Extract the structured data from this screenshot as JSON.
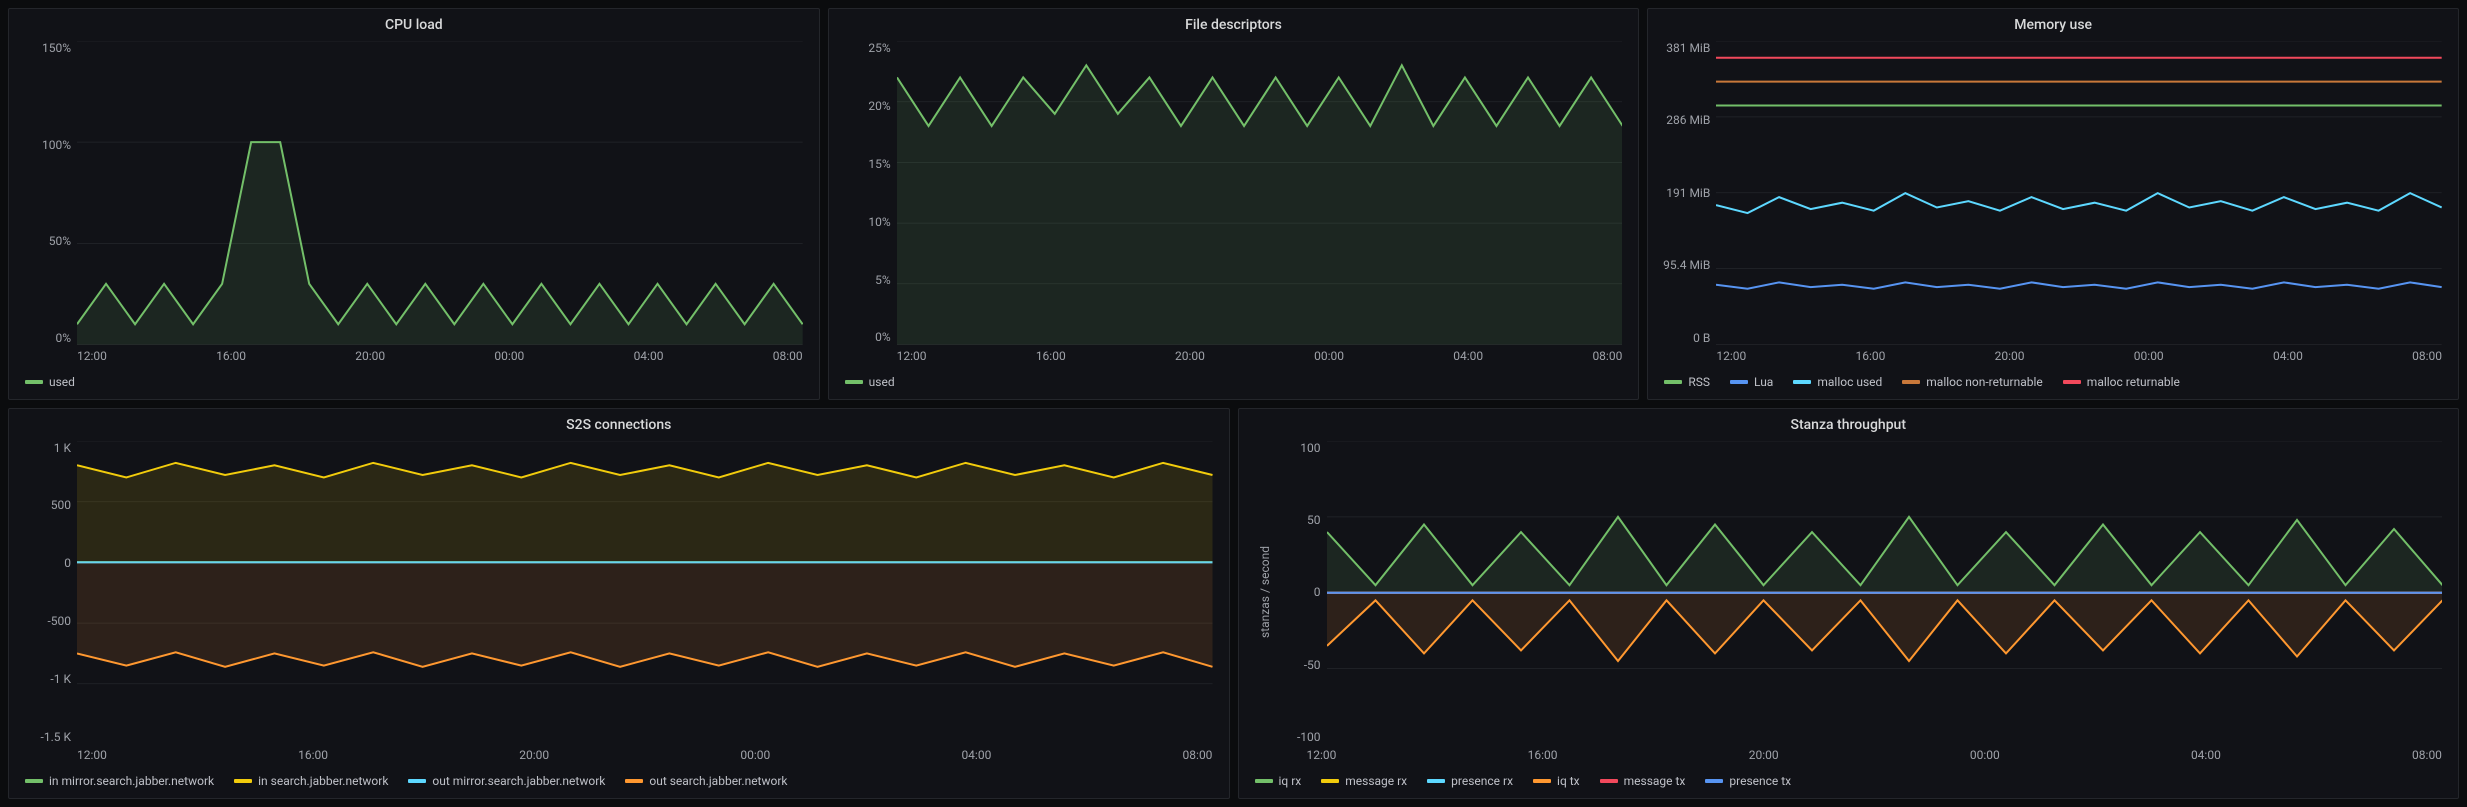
{
  "time_axis": [
    "12:00",
    "16:00",
    "20:00",
    "00:00",
    "04:00",
    "08:00"
  ],
  "palette": {
    "green": "#73bf69",
    "yellow": "#f2cc0c",
    "cyan": "#5dd8ff",
    "blue": "#5794f2",
    "orange": "#ff9830",
    "darkorange": "#c9783a",
    "red": "#f2495c"
  },
  "panels": {
    "cpu": {
      "title": "CPU load",
      "yticks": [
        "150%",
        "100%",
        "50%",
        "0%"
      ],
      "ylim": [
        0,
        150
      ],
      "legend": [
        {
          "label": "used",
          "color": "green"
        }
      ]
    },
    "fd": {
      "title": "File descriptors",
      "yticks": [
        "25%",
        "20%",
        "15%",
        "10%",
        "5%",
        "0%"
      ],
      "ylim": [
        0,
        25
      ],
      "legend": [
        {
          "label": "used",
          "color": "green"
        }
      ]
    },
    "mem": {
      "title": "Memory use",
      "yticks": [
        "381 MiB",
        "286 MiB",
        "191 MiB",
        "95.4 MiB",
        "0 B"
      ],
      "ylim": [
        0,
        381
      ],
      "legend": [
        {
          "label": "RSS",
          "color": "green"
        },
        {
          "label": "Lua",
          "color": "blue"
        },
        {
          "label": "malloc used",
          "color": "cyan"
        },
        {
          "label": "malloc non-returnable",
          "color": "darkorange"
        },
        {
          "label": "malloc returnable",
          "color": "red"
        }
      ]
    },
    "s2s": {
      "title": "S2S connections",
      "yticks": [
        "1 K",
        "500",
        "0",
        "-500",
        "-1 K",
        "-1.5 K"
      ],
      "ylim": [
        -1500,
        1000
      ],
      "legend": [
        {
          "label": "in mirror.search.jabber.network",
          "color": "green"
        },
        {
          "label": "in search.jabber.network",
          "color": "yellow"
        },
        {
          "label": "out mirror.search.jabber.network",
          "color": "cyan"
        },
        {
          "label": "out search.jabber.network",
          "color": "orange"
        }
      ]
    },
    "stanza": {
      "title": "Stanza throughput",
      "yticks": [
        "100",
        "50",
        "0",
        "-50",
        "-100"
      ],
      "ylim": [
        -100,
        100
      ],
      "ylabel": "stanzas / second",
      "legend": [
        {
          "label": "iq rx",
          "color": "green"
        },
        {
          "label": "message rx",
          "color": "yellow"
        },
        {
          "label": "presence rx",
          "color": "cyan"
        },
        {
          "label": "iq tx",
          "color": "orange"
        },
        {
          "label": "message tx",
          "color": "red"
        },
        {
          "label": "presence tx",
          "color": "blue"
        }
      ]
    }
  },
  "chart_data": [
    {
      "id": "cpu",
      "type": "line",
      "title": "CPU load",
      "xlabel": "",
      "ylabel": "",
      "ylim": [
        0,
        150
      ],
      "x": [
        12,
        13,
        14,
        15,
        16,
        17,
        17.3,
        17.8,
        18,
        19,
        20,
        21,
        22,
        23,
        0,
        1,
        2,
        3,
        4,
        5,
        6,
        7,
        8,
        9,
        10,
        11
      ],
      "series": [
        {
          "name": "used",
          "color": "#73bf69",
          "values": [
            10,
            30,
            10,
            30,
            10,
            30,
            100,
            100,
            30,
            10,
            30,
            10,
            30,
            10,
            30,
            10,
            30,
            10,
            30,
            10,
            30,
            10,
            30,
            10,
            30,
            10
          ]
        }
      ]
    },
    {
      "id": "fd",
      "type": "line",
      "title": "File descriptors",
      "xlabel": "",
      "ylabel": "",
      "ylim": [
        0,
        25
      ],
      "x": [
        12,
        13,
        14,
        15,
        16,
        17,
        18,
        19,
        20,
        21,
        22,
        23,
        0,
        1,
        2,
        3,
        4,
        5,
        6,
        7,
        8,
        9,
        10,
        11
      ],
      "series": [
        {
          "name": "used",
          "color": "#73bf69",
          "values": [
            22,
            18,
            22,
            18,
            22,
            19,
            23,
            19,
            22,
            18,
            22,
            18,
            22,
            18,
            22,
            18,
            23,
            18,
            22,
            18,
            22,
            18,
            22,
            18
          ]
        }
      ]
    },
    {
      "id": "mem",
      "type": "line",
      "title": "Memory use",
      "xlabel": "",
      "ylabel": "",
      "ylim": [
        0,
        381
      ],
      "x": [
        12,
        13,
        14,
        15,
        16,
        17,
        18,
        19,
        20,
        21,
        22,
        23,
        0,
        1,
        2,
        3,
        4,
        5,
        6,
        7,
        8,
        9,
        10,
        11
      ],
      "series": [
        {
          "name": "RSS",
          "color": "#73bf69",
          "values": [
            300,
            300,
            300,
            300,
            300,
            300,
            300,
            300,
            300,
            300,
            300,
            300,
            300,
            300,
            300,
            300,
            300,
            300,
            300,
            300,
            300,
            300,
            300,
            300
          ]
        },
        {
          "name": "Lua",
          "color": "#5794f2",
          "values": [
            75,
            70,
            78,
            72,
            75,
            70,
            78,
            72,
            75,
            70,
            78,
            72,
            75,
            70,
            78,
            72,
            75,
            70,
            78,
            72,
            75,
            70,
            78,
            72
          ]
        },
        {
          "name": "malloc used",
          "color": "#5dd8ff",
          "values": [
            175,
            165,
            185,
            170,
            178,
            168,
            190,
            172,
            180,
            168,
            185,
            170,
            178,
            168,
            190,
            172,
            180,
            168,
            185,
            170,
            178,
            168,
            190,
            172
          ]
        },
        {
          "name": "malloc non-returnable",
          "color": "#c9783a",
          "values": [
            330,
            330,
            330,
            330,
            330,
            330,
            330,
            330,
            330,
            330,
            330,
            330,
            330,
            330,
            330,
            330,
            330,
            330,
            330,
            330,
            330,
            330,
            330,
            330
          ]
        },
        {
          "name": "malloc returnable",
          "color": "#f2495c",
          "values": [
            360,
            360,
            360,
            360,
            360,
            360,
            360,
            360,
            360,
            360,
            360,
            360,
            360,
            360,
            360,
            360,
            360,
            360,
            360,
            360,
            360,
            360,
            360,
            360
          ]
        }
      ]
    },
    {
      "id": "s2s",
      "type": "line",
      "title": "S2S connections",
      "xlabel": "",
      "ylabel": "",
      "ylim": [
        -1500,
        1000
      ],
      "x": [
        12,
        13,
        14,
        15,
        16,
        17,
        18,
        19,
        20,
        21,
        22,
        23,
        0,
        1,
        2,
        3,
        4,
        5,
        6,
        7,
        8,
        9,
        10,
        11
      ],
      "series": [
        {
          "name": "in mirror.search.jabber.network",
          "color": "#73bf69",
          "values": [
            2,
            2,
            2,
            2,
            2,
            2,
            2,
            2,
            2,
            2,
            2,
            2,
            2,
            2,
            2,
            2,
            2,
            2,
            2,
            2,
            2,
            2,
            2,
            2
          ]
        },
        {
          "name": "in search.jabber.network",
          "color": "#f2cc0c",
          "values": [
            800,
            700,
            820,
            720,
            800,
            700,
            820,
            720,
            800,
            700,
            820,
            720,
            800,
            700,
            820,
            720,
            800,
            700,
            820,
            720,
            800,
            700,
            820,
            720
          ]
        },
        {
          "name": "out mirror.search.jabber.network",
          "color": "#5dd8ff",
          "values": [
            0,
            0,
            0,
            0,
            0,
            0,
            0,
            0,
            0,
            0,
            0,
            0,
            0,
            0,
            0,
            0,
            0,
            0,
            0,
            0,
            0,
            0,
            0,
            0
          ]
        },
        {
          "name": "out search.jabber.network",
          "color": "#ff9830",
          "values": [
            -750,
            -850,
            -740,
            -860,
            -750,
            -850,
            -740,
            -860,
            -750,
            -850,
            -740,
            -860,
            -750,
            -850,
            -740,
            -860,
            -750,
            -850,
            -740,
            -860,
            -750,
            -850,
            -740,
            -860
          ]
        }
      ]
    },
    {
      "id": "stanza",
      "type": "line",
      "title": "Stanza throughput",
      "xlabel": "",
      "ylabel": "stanzas / second",
      "ylim": [
        -100,
        100
      ],
      "x": [
        12,
        13,
        14,
        15,
        16,
        17,
        18,
        19,
        20,
        21,
        22,
        23,
        0,
        1,
        2,
        3,
        4,
        5,
        6,
        7,
        8,
        9,
        10,
        11
      ],
      "series": [
        {
          "name": "iq rx",
          "color": "#73bf69",
          "values": [
            40,
            5,
            45,
            5,
            40,
            5,
            50,
            5,
            45,
            5,
            40,
            5,
            50,
            5,
            40,
            5,
            45,
            5,
            40,
            5,
            48,
            5,
            42,
            5
          ]
        },
        {
          "name": "message rx",
          "color": "#f2cc0c",
          "values": [
            0,
            0,
            0,
            0,
            0,
            0,
            0,
            0,
            0,
            0,
            0,
            0,
            0,
            0,
            0,
            0,
            0,
            0,
            0,
            0,
            0,
            0,
            0,
            0
          ]
        },
        {
          "name": "presence rx",
          "color": "#5dd8ff",
          "values": [
            0,
            0,
            0,
            0,
            0,
            0,
            0,
            0,
            0,
            0,
            0,
            0,
            0,
            0,
            0,
            0,
            0,
            0,
            0,
            0,
            0,
            0,
            0,
            0
          ]
        },
        {
          "name": "iq tx",
          "color": "#ff9830",
          "values": [
            -35,
            -5,
            -40,
            -5,
            -38,
            -5,
            -45,
            -5,
            -40,
            -5,
            -38,
            -5,
            -45,
            -5,
            -40,
            -5,
            -38,
            -5,
            -40,
            -5,
            -42,
            -5,
            -38,
            -5
          ]
        },
        {
          "name": "message tx",
          "color": "#f2495c",
          "values": [
            0,
            0,
            0,
            0,
            0,
            0,
            0,
            0,
            0,
            0,
            0,
            0,
            0,
            0,
            0,
            0,
            0,
            0,
            0,
            0,
            0,
            0,
            0,
            0
          ]
        },
        {
          "name": "presence tx",
          "color": "#5794f2",
          "values": [
            0,
            0,
            0,
            0,
            0,
            0,
            0,
            0,
            0,
            0,
            0,
            0,
            0,
            0,
            0,
            0,
            0,
            0,
            0,
            0,
            0,
            0,
            0,
            0
          ]
        }
      ]
    }
  ]
}
